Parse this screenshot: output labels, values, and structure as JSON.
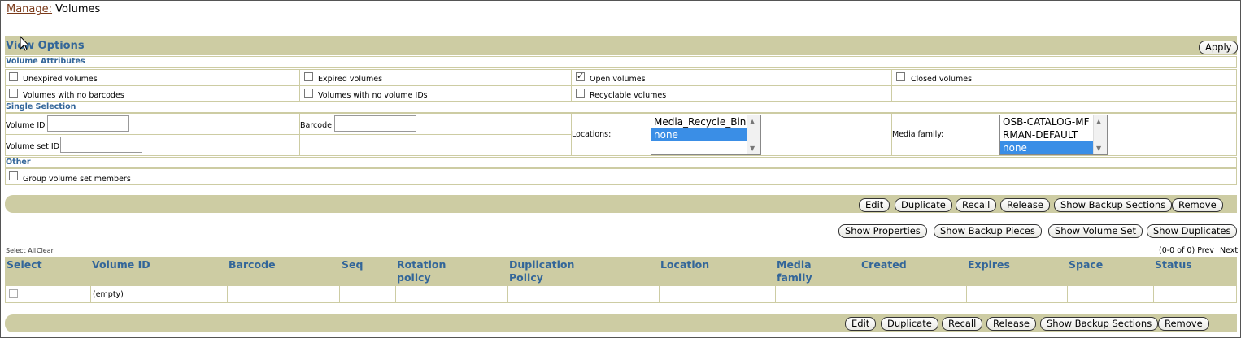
{
  "breadcrumb": {
    "link": "Manage:",
    "current": "Volumes"
  },
  "view_options": {
    "title": "View Options",
    "apply_label": "Apply",
    "volume_attributes": {
      "heading": "Volume Attributes",
      "checkboxes": [
        {
          "label": "Unexpired volumes",
          "checked": false
        },
        {
          "label": "Expired volumes",
          "checked": false
        },
        {
          "label": "Open volumes",
          "checked": true
        },
        {
          "label": "Closed volumes",
          "checked": false
        },
        {
          "label": "Volumes with no barcodes",
          "checked": false
        },
        {
          "label": "Volumes with no volume IDs",
          "checked": false
        },
        {
          "label": "Recyclable volumes",
          "checked": false
        }
      ]
    },
    "single_selection": {
      "heading": "Single Selection",
      "volume_id_label": "Volume ID",
      "volume_id_value": "",
      "barcode_label": "Barcode",
      "barcode_value": "",
      "volume_set_id_label": "Volume set ID",
      "volume_set_id_value": "",
      "locations_label": "Locations:",
      "locations_options": [
        "Media_Recycle_Bin",
        "none"
      ],
      "locations_selected": "none",
      "media_family_label": "Media family:",
      "media_family_options": [
        "OSB-CATALOG-MF",
        "RMAN-DEFAULT",
        "none"
      ],
      "media_family_selected": "none"
    },
    "other": {
      "heading": "Other",
      "group_label": "Group volume set members",
      "group_checked": false
    }
  },
  "toolbar_top": {
    "row1": [
      "Edit",
      "Duplicate",
      "Recall",
      "Release",
      "Show Backup Sections",
      "Remove"
    ],
    "row2": [
      "Show Properties",
      "Show Backup Pieces",
      "Show Volume Set",
      "Show Duplicates"
    ]
  },
  "table": {
    "select_all": "Select All",
    "clear": "Clear",
    "pagination": "(0-0 of 0)",
    "prev": "Prev",
    "next": "Next",
    "columns": [
      {
        "line1": "",
        "line2": "Select"
      },
      {
        "line1": "",
        "line2": "Volume ID"
      },
      {
        "line1": "",
        "line2": "Barcode"
      },
      {
        "line1": "",
        "line2": "Seq"
      },
      {
        "line1": "Rotation",
        "line2": "policy"
      },
      {
        "line1": "Duplication",
        "line2": "Policy"
      },
      {
        "line1": "",
        "line2": "Location"
      },
      {
        "line1": "Media",
        "line2": "family"
      },
      {
        "line1": "",
        "line2": "Created"
      },
      {
        "line1": "",
        "line2": "Expires"
      },
      {
        "line1": "",
        "line2": "Space"
      },
      {
        "line1": "",
        "line2": "Status"
      }
    ],
    "empty_text": "(empty)"
  },
  "toolbar_bottom": [
    "Edit",
    "Duplicate",
    "Recall",
    "Release",
    "Show Backup Sections",
    "Remove"
  ],
  "colors": {
    "band": "#cdcca3",
    "heading": "#336699",
    "link": "#7a3a1a",
    "selected": "#3a8ee6"
  }
}
